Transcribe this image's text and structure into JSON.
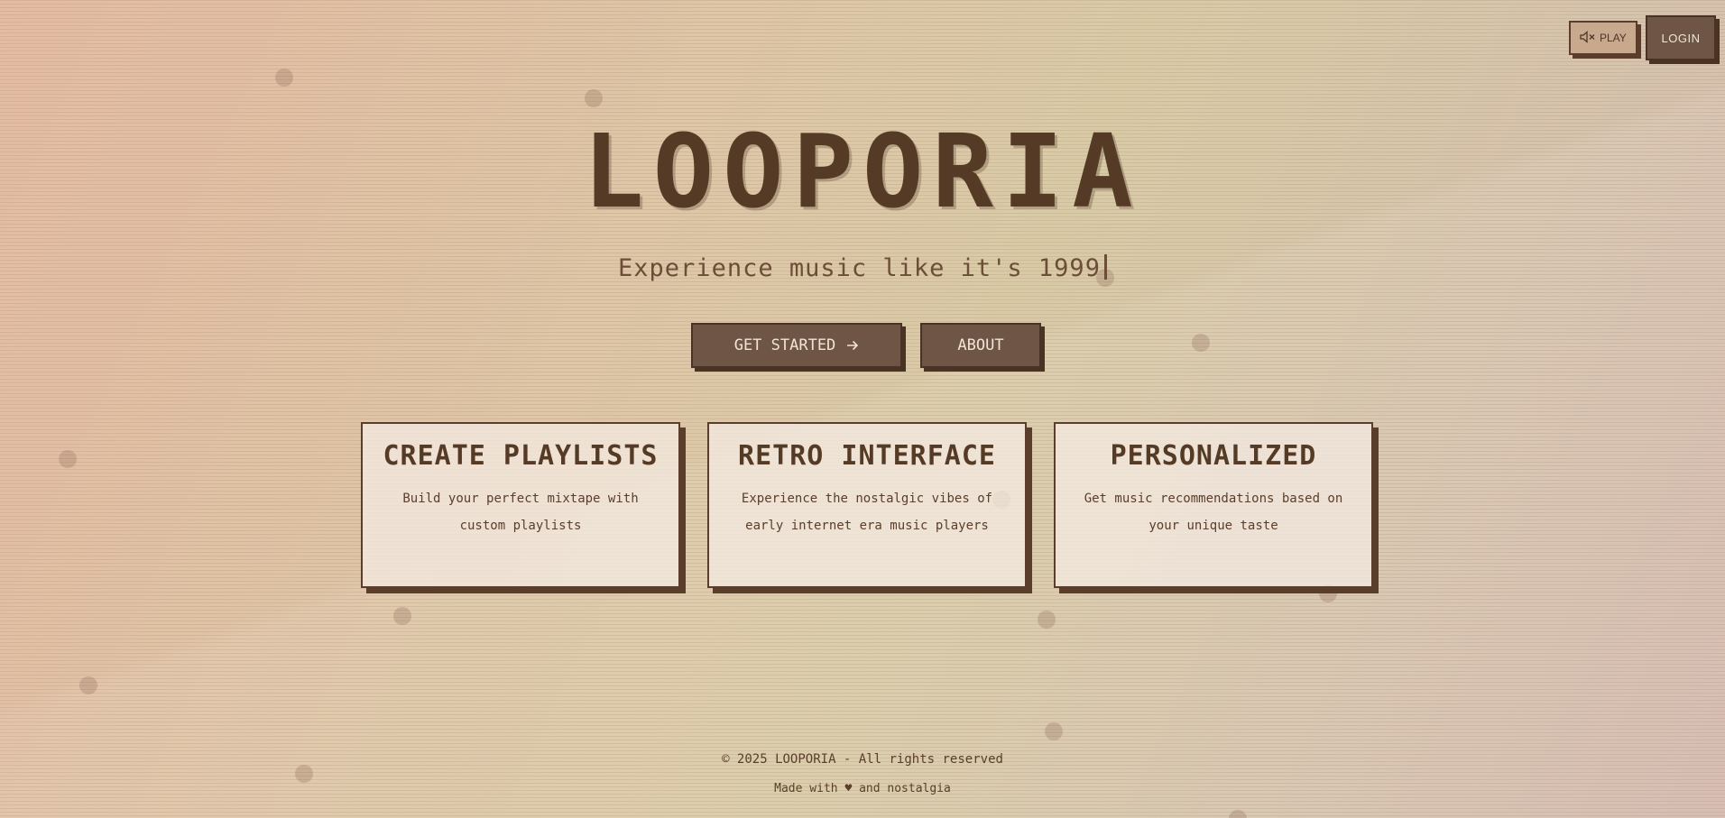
{
  "controls": {
    "sound_label": "PLAY",
    "sound_icon": "speaker-muted-icon",
    "login_label": "LOGIN"
  },
  "hero": {
    "title": "LOOPORIA",
    "tagline": "Experience music like it's 1999"
  },
  "cta": {
    "get_started_label": "GET STARTED",
    "get_started_icon": "arrow-right-icon",
    "about_label": "ABOUT"
  },
  "features": [
    {
      "title": "CREATE PLAYLISTS",
      "description": "Build your perfect mixtape with custom playlists"
    },
    {
      "title": "RETRO INTERFACE",
      "description": "Experience the nostalgic vibes of early internet era music players"
    },
    {
      "title": "PERSONALIZED",
      "description": "Get music recommendations based on your unique taste"
    }
  ],
  "footer": {
    "copyright": "© 2025 LOOPORIA - All rights reserved",
    "made_with_prefix": "Made with",
    "heart": "♥",
    "made_with_suffix": "and nostalgia"
  },
  "colors": {
    "primary_brown": "#5a3e2b",
    "button_brown": "#6f5545",
    "card_bg": "#f3e9e0",
    "bg_peach": "#e4bba3",
    "bg_sand": "#d9caa6"
  }
}
